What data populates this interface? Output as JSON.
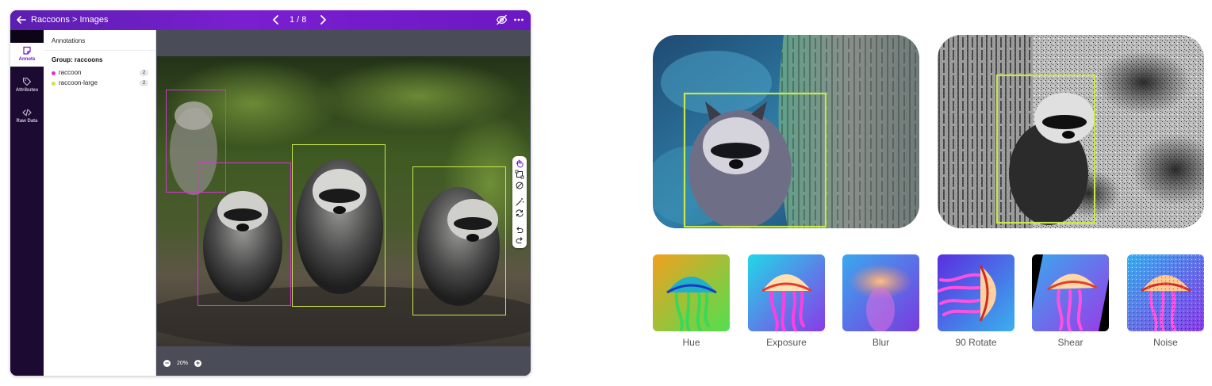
{
  "app": {
    "breadcrumb": "Raccoons > Images",
    "counter": "1 / 8",
    "accent_color": "#6b18c4"
  },
  "sidebar": {
    "items": [
      {
        "label": "Annots",
        "icon": "note-icon",
        "active": true
      },
      {
        "label": "Attributes",
        "icon": "tag-icon",
        "active": false
      },
      {
        "label": "Raw Data",
        "icon": "code-icon",
        "active": false
      }
    ]
  },
  "panel": {
    "title": "Annotations",
    "group": "Group: raccoons",
    "classes": [
      {
        "name": "raccoon",
        "count": "2",
        "color": "#d633d6"
      },
      {
        "name": "raccoon-large",
        "count": "2",
        "color": "#c8e84a"
      }
    ]
  },
  "canvas": {
    "zoom": "20%",
    "tools": [
      "hand-icon",
      "bounding-box-icon",
      "polygon-icon",
      "magic-wand-icon",
      "repeat-icon",
      "undo-icon",
      "redo-icon"
    ]
  },
  "augmentations": [
    {
      "label": "Hue"
    },
    {
      "label": "Exposure"
    },
    {
      "label": "Blur"
    },
    {
      "label": "90 Rotate"
    },
    {
      "label": "Shear"
    },
    {
      "label": "Noise"
    }
  ]
}
